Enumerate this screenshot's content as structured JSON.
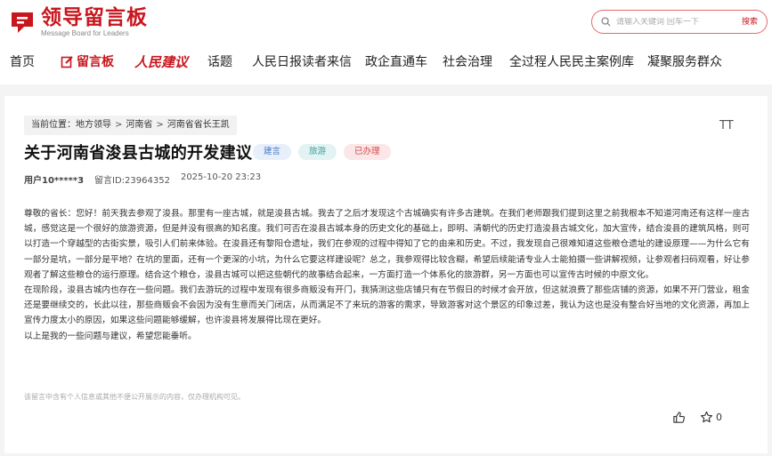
{
  "header": {
    "logo_title": "领导留言板",
    "logo_subtitle": "Message Board for Leaders",
    "search_placeholder": "请输入关键词 回车一下",
    "search_button": "搜索"
  },
  "nav": {
    "items": [
      "首页",
      "留言板",
      "人民建议",
      "话题",
      "人民日报读者来信",
      "政企直通车",
      "社会治理",
      "全过程人民民主案例库",
      "凝聚服务群众"
    ]
  },
  "breadcrumb": {
    "prefix": "当前位置：",
    "items": [
      "地方领导",
      "河南省",
      "河南省省长王凯"
    ],
    "separator": ">"
  },
  "post": {
    "title": "关于河南省浚县古城的开发建议",
    "tags": [
      "建言",
      "旅游",
      "已办理"
    ],
    "user": "用户10*****3",
    "message_id": "留言ID:23964352",
    "datetime": "2025-10-20 23:23",
    "paragraphs": [
      "尊敬的省长：您好！前天我去参观了浚县。那里有一座古城，就是浚县古城。我去了之后才发现这个古城确实有许多古建筑。在我们老师跟我们提到这里之前我根本不知道河南还有这样一座古城，感觉这是一个很好的旅游资源，但是并没有很高的知名度。我们可否在浚县古城本身的历史文化的基础上，即明、清朝代的历史打造浚县古城文化，加大宣传，结合浚县的建筑风格，则可以打造一个穿越型的古街实景，吸引人们前来体验。在浚县还有黎阳仓遗址，我们在参观的过程中得知了它的由来和历史。不过，我发现自己很难知道这些粮仓遗址的建设原理——为什么它有一部分是坑，一部分是平地？在坑的里面，还有一个更深的小坑，为什么它要这样建设呢？总之，我参观得比较含糊，希望后续能请专业人士能拍摄一些讲解视频，让参观者扫码观看，好让参观者了解这些粮仓的运行原理。结合这个粮仓，浚县古城可以把这些朝代的故事结合起来，一方面打造一个体系化的旅游群，另一方面也可以宣传古时候的中原文化。",
      "在现阶段，浚县古城内也存在一些问题。我们去游玩的过程中发现有很多商贩没有开门，我猜测这些店铺只有在节假日的时候才会开放，但这就浪费了那些店铺的资源，如果不开门营业，租金还是要继续交的，长此以往，那些商贩会不会因为没有生意而关门闭店，从而满足不了来玩的游客的需求，导致游客对这个景区的印象过差，我认为这也是没有整合好当地的文化资源，再加上宣传力度太小的原因，如果这些问题能够缓解，也许浚县将发展得比现在更好。",
      "以上是我的一些问题与建议，希望您能垂听。"
    ],
    "privacy_note": "该留言中含有个人信息或其他不便公开展示的内容，仅办理机构可见。",
    "font_size_icon_label": "TT",
    "favorite_count": "0"
  },
  "colors": {
    "brand_red": "#c8161d",
    "tag_blue": "#4a78c2",
    "tag_teal": "#3e9a9a",
    "tag_red": "#d24a4a"
  },
  "icons": [
    "logo-icon",
    "search-icon",
    "message-board-icon",
    "font-size-icon",
    "thumbs-up-icon",
    "star-icon"
  ]
}
